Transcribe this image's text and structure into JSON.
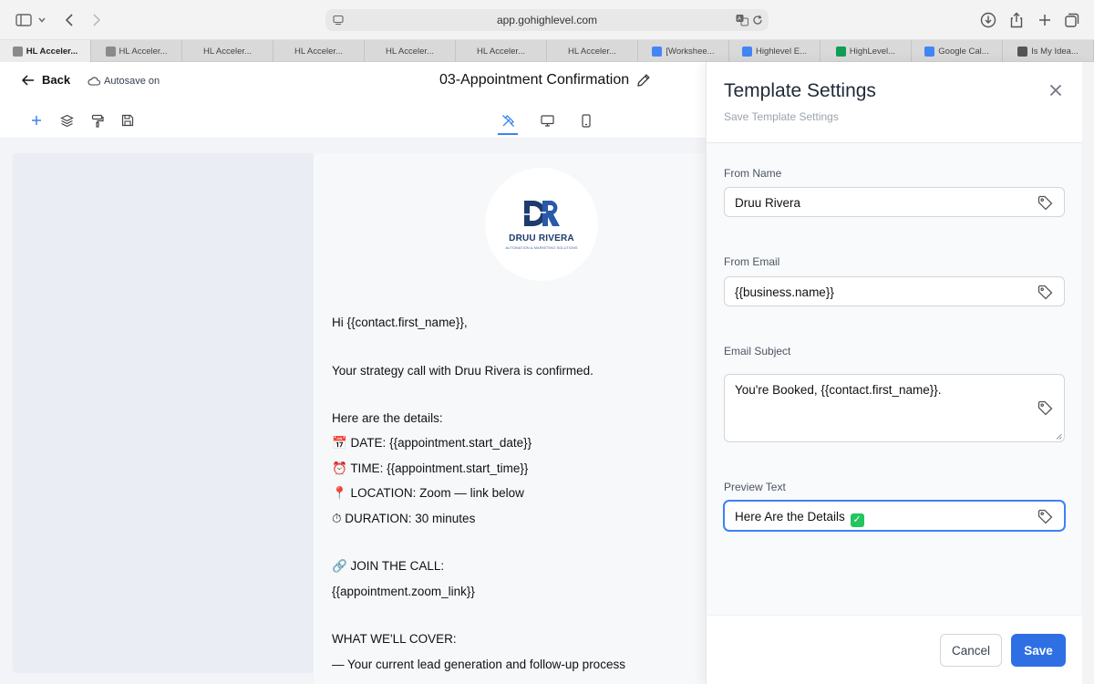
{
  "browser": {
    "url": "app.gohighlevel.com",
    "tabs": [
      {
        "label": "HL Acceler...",
        "icon": "g-favicon",
        "color": "#8a8a8a",
        "active": true
      },
      {
        "label": "HL Acceler...",
        "icon": "g-favicon",
        "color": "#8a8a8a"
      },
      {
        "label": "HL Acceler...",
        "icon": "",
        "color": ""
      },
      {
        "label": "HL Acceler...",
        "icon": "",
        "color": ""
      },
      {
        "label": "HL Acceler...",
        "icon": "",
        "color": ""
      },
      {
        "label": "HL Acceler...",
        "icon": "",
        "color": ""
      },
      {
        "label": "HL Acceler...",
        "icon": "",
        "color": ""
      },
      {
        "label": "[Workshee...",
        "icon": "docs-favicon",
        "color": "#4285f4"
      },
      {
        "label": "Highlevel E...",
        "icon": "docs-favicon",
        "color": "#4285f4"
      },
      {
        "label": "HighLevel...",
        "icon": "sheets-favicon",
        "color": "#0f9d58"
      },
      {
        "label": "Google Cal...",
        "icon": "calendar-favicon",
        "color": "#4285f4"
      },
      {
        "label": "Is My Idea...",
        "icon": "page-favicon",
        "color": "#555555"
      }
    ]
  },
  "header": {
    "back_label": "Back",
    "autosave_label": "Autosave on",
    "title": "03-Appointment Confirmation"
  },
  "email": {
    "logo_text": "DRUU RIVERA",
    "logo_tagline": "AUTOMATION & MARKETING SOLUTIONS",
    "lines": [
      "Hi {{contact.first_name}},",
      "Your strategy call with Druu Rivera is confirmed.",
      "Here are the details:",
      "📅 DATE: {{appointment.start_date}}",
      "⏰ TIME: {{appointment.start_time}}",
      "📍 LOCATION: Zoom — link below",
      "⏱ DURATION: 30 minutes",
      "🔗 JOIN THE CALL:",
      "{{appointment.zoom_link}}",
      "WHAT WE'LL COVER:",
      "— Your current lead generation and follow-up process"
    ]
  },
  "panel": {
    "title": "Template Settings",
    "subtitle": "Save Template Settings",
    "from_name_label": "From Name",
    "from_name_value": "Druu Rivera",
    "from_email_label": "From Email",
    "from_email_value": "{{business.name}}",
    "subject_label": "Email Subject",
    "subject_value": "You're Booked, {{contact.first_name}}.",
    "preview_label": "Preview Text",
    "preview_value": "Here Are the Details",
    "cancel_label": "Cancel",
    "save_label": "Save"
  },
  "colors": {
    "accent": "#2f6fe4",
    "logo_navy": "#1d3b6e"
  }
}
